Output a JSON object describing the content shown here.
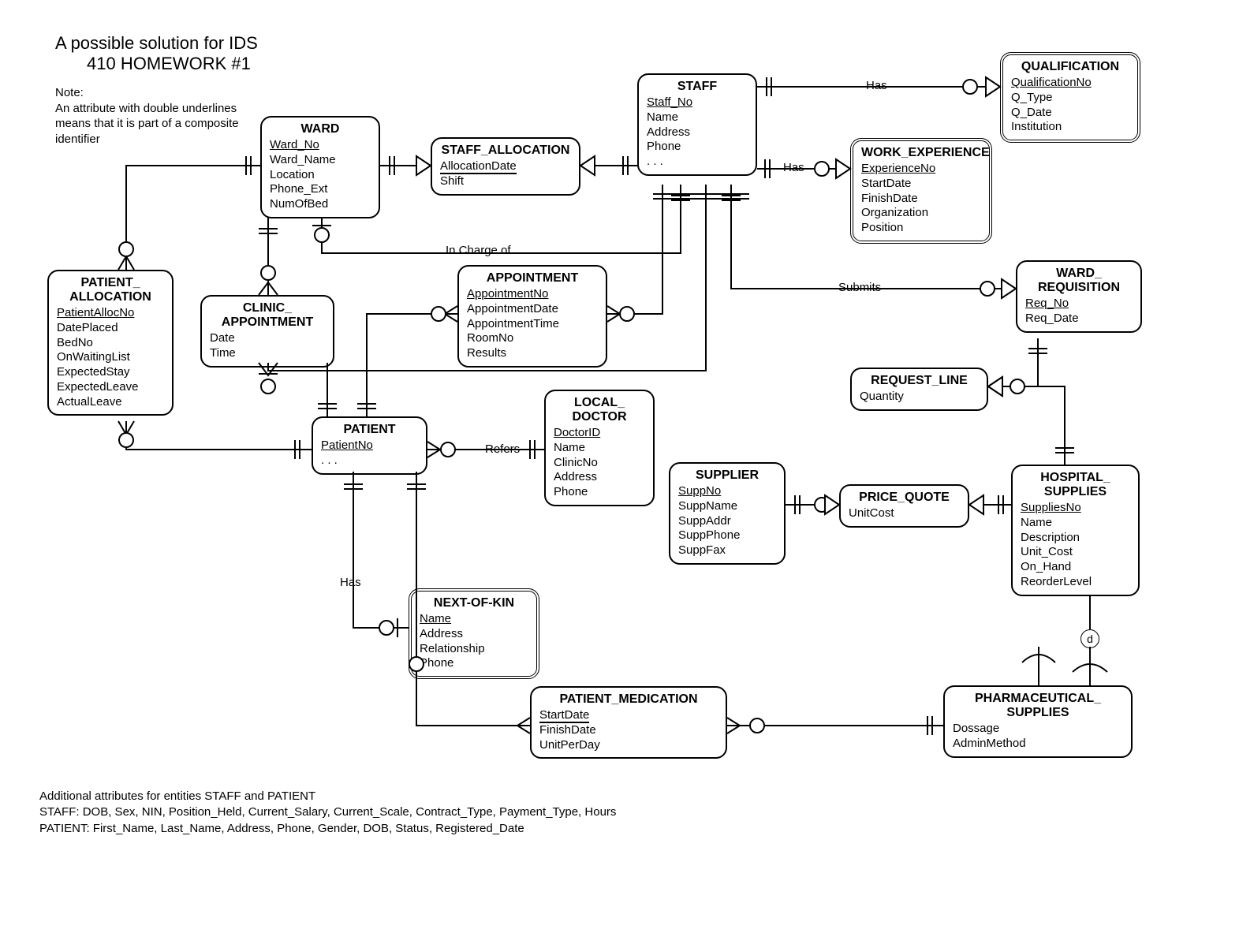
{
  "title_line1": "A possible solution for IDS",
  "title_line2": "410 HOMEWORK #1",
  "note": "Note:\nAn attribute with double underlines  means that it is part of a composite identifier",
  "footer_heading": "Additional attributes for entities STAFF and PATIENT",
  "footer_staff": "STAFF: DOB, Sex, NIN, Position_Held, Current_Salary, Current_Scale, Contract_Type, Payment_Type, Hours",
  "footer_patient": "PATIENT: First_Name, Last_Name, Address, Phone, Gender, DOB, Status, Registered_Date",
  "rels": {
    "in_charge": "In Charge of",
    "has_qual": "Has",
    "has_exp": "Has",
    "refers": "Refers",
    "has_nok": "Has",
    "submits": "Submits",
    "d": "d"
  },
  "entities": {
    "ward": {
      "name": "WARD",
      "attrs": [
        "Ward_No",
        "Ward_Name",
        "Location",
        "Phone_Ext",
        "NumOfBed"
      ],
      "pk": [
        0
      ]
    },
    "staff": {
      "name": "STAFF",
      "attrs": [
        "Staff_No",
        "Name",
        "Address",
        "Phone",
        ". . ."
      ],
      "pk": [
        0
      ]
    },
    "qualification": {
      "name": "QUALIFICATION",
      "attrs": [
        "QualificationNo",
        "Q_Type",
        "Q_Date",
        "Institution"
      ],
      "pk": [
        0
      ],
      "weak": true
    },
    "work_exp": {
      "name": "WORK_EXPERIENCE",
      "attrs": [
        "ExperienceNo",
        "StartDate",
        "FinishDate",
        "Organization",
        "Position"
      ],
      "pk": [
        0
      ],
      "weak": true
    },
    "staff_alloc": {
      "name": "STAFF_ALLOCATION",
      "attrs": [
        "AllocationDate",
        "Shift"
      ],
      "pk2": [
        0
      ]
    },
    "patient_alloc": {
      "name": "PATIENT_\nALLOCATION",
      "attrs": [
        "PatientAllocNo",
        "DatePlaced",
        "BedNo",
        "OnWaitingList",
        "ExpectedStay",
        "ExpectedLeave",
        "ActualLeave"
      ],
      "pk": [
        0
      ]
    },
    "clinic_appt": {
      "name": "CLINIC_\nAPPOINTMENT",
      "attrs": [
        "Date",
        "Time"
      ]
    },
    "appointment": {
      "name": "APPOINTMENT",
      "attrs": [
        "AppointmentNo",
        "AppointmentDate",
        "AppointmentTime",
        "RoomNo",
        "Results"
      ],
      "pk": [
        0
      ]
    },
    "patient": {
      "name": "PATIENT",
      "attrs": [
        "PatientNo",
        ". . ."
      ],
      "pk": [
        0
      ]
    },
    "local_doctor": {
      "name": "LOCAL_\nDOCTOR",
      "attrs": [
        "DoctorID",
        "Name",
        "ClinicNo",
        "Address",
        "Phone"
      ],
      "pk": [
        0
      ]
    },
    "next_of_kin": {
      "name": "NEXT-OF-KIN",
      "attrs": [
        "Name",
        "Address",
        "Relationship",
        "Phone"
      ],
      "pk": [
        0
      ],
      "weak": true
    },
    "supplier": {
      "name": "SUPPLIER",
      "attrs": [
        "SuppNo",
        "SuppName",
        "SuppAddr",
        "SuppPhone",
        "SuppFax"
      ],
      "pk": [
        0
      ]
    },
    "price_quote": {
      "name": "PRICE_QUOTE",
      "attrs": [
        "UnitCost"
      ]
    },
    "ward_req": {
      "name": "WARD_\nREQUISITION",
      "attrs": [
        "Req_No",
        "Req_Date"
      ],
      "pk": [
        0
      ]
    },
    "request_line": {
      "name": "REQUEST_LINE",
      "attrs": [
        "Quantity"
      ]
    },
    "hospital_supplies": {
      "name": "HOSPITAL_\nSUPPLIES",
      "attrs": [
        "SuppliesNo",
        "Name",
        "Description",
        "Unit_Cost",
        "On_Hand",
        "ReorderLevel"
      ],
      "pk": [
        0
      ]
    },
    "pharmaceutical": {
      "name": "PHARMACEUTICAL_\nSUPPLIES",
      "attrs": [
        "Dossage",
        "AdminMethod"
      ]
    },
    "patient_med": {
      "name": "PATIENT_MEDICATION",
      "attrs": [
        "StartDate",
        "FinishDate",
        "UnitPerDay"
      ],
      "pk2": [
        0
      ]
    }
  }
}
